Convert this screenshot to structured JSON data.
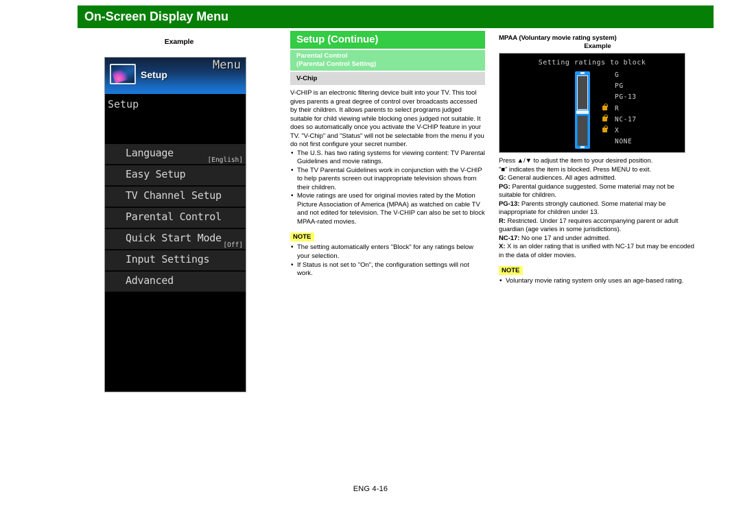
{
  "header": {
    "title": "On-Screen Display Menu",
    "bar_color": "#067f06"
  },
  "left_column": {
    "example_label": "Example",
    "tv_menu": {
      "menu_word": "Menu",
      "icon_label": "Setup",
      "screen_title": "Setup",
      "items": [
        {
          "label": "Language",
          "value": "[English]"
        },
        {
          "label": "Easy Setup",
          "value": ""
        },
        {
          "label": "TV Channel Setup",
          "value": ""
        },
        {
          "label": "Parental Control",
          "value": ""
        },
        {
          "label": "Quick Start Mode",
          "value": "[Off]"
        },
        {
          "label": "Input Settings",
          "value": ""
        },
        {
          "label": "Advanced",
          "value": ""
        }
      ]
    }
  },
  "middle_column": {
    "section_title": "Setup (Continue)",
    "subsection_line1": "Parental Control",
    "subsection_line2": "(Parental Control Setting)",
    "topic": "V-Chip",
    "paragraph": "V-CHIP is an electronic filtering device built into your TV. This tool gives parents a great degree of control over broadcasts accessed by their children. It allows parents to select programs judged suitable for child viewing while blocking ones judged not suitable. It does so automatically once you activate the V-CHIP feature in your TV. \"V-Chip\" and \"Status\" will not be selectable from the menu if you do not first configure your secret number.",
    "bullets": [
      "The U.S. has two rating systems for viewing content: TV Parental Guidelines and movie ratings.",
      "The TV Parental Guidelines work in conjunction with the V-CHIP to help parents screen out inappropriate television shows from their children.",
      "Movie ratings are used for original movies rated by the Motion Picture Association of America (MPAA) as watched on cable TV and not edited for television. The V-CHIP can also be set to block MPAA-rated movies."
    ],
    "note_label": "NOTE",
    "note_bullets": [
      "The setting automatically enters \"Block\" for any ratings below your selection.",
      "If Status is not set to \"On\", the configuration settings will not work."
    ]
  },
  "right_column": {
    "mpaa_title": "MPAA (Voluntary movie rating system)",
    "example_label": "Example",
    "tv_screen": {
      "screen_title": "Setting ratings to block",
      "ratings": [
        {
          "name": "G",
          "locked": false
        },
        {
          "name": "PG",
          "locked": false
        },
        {
          "name": "PG-13",
          "locked": false
        },
        {
          "name": "R",
          "locked": true
        },
        {
          "name": "NC-17",
          "locked": true
        },
        {
          "name": "X",
          "locked": true
        },
        {
          "name": "NONE",
          "locked": false
        }
      ]
    },
    "instructions": [
      "Press ▲/▼ to adjust the item to your desired position.",
      "\"■\" indicates the item is blocked. Press MENU to exit."
    ],
    "definitions": [
      {
        "term": "G:",
        "text": " General audiences. All ages admitted."
      },
      {
        "term": "PG:",
        "text": " Parental guidance suggested. Some material may not be suitable for children."
      },
      {
        "term": "PG-13:",
        "text": " Parents strongly cautioned. Some material may be inappropriate for children under 13."
      },
      {
        "term": "R:",
        "text": " Restricted. Under 17 requires accompanying parent or adult guardian (age varies in some jurisdictions)."
      },
      {
        "term": "NC-17:",
        "text": " No one 17 and under admitted."
      },
      {
        "term": "X:",
        "text": " X is an older rating that is unified with NC-17 but may be encoded in the data of older movies."
      }
    ],
    "note_label": "NOTE",
    "note_bullets": [
      "Voluntary movie rating system only uses an age-based rating."
    ]
  },
  "footer": {
    "page_marker": "ENG 4-16"
  }
}
